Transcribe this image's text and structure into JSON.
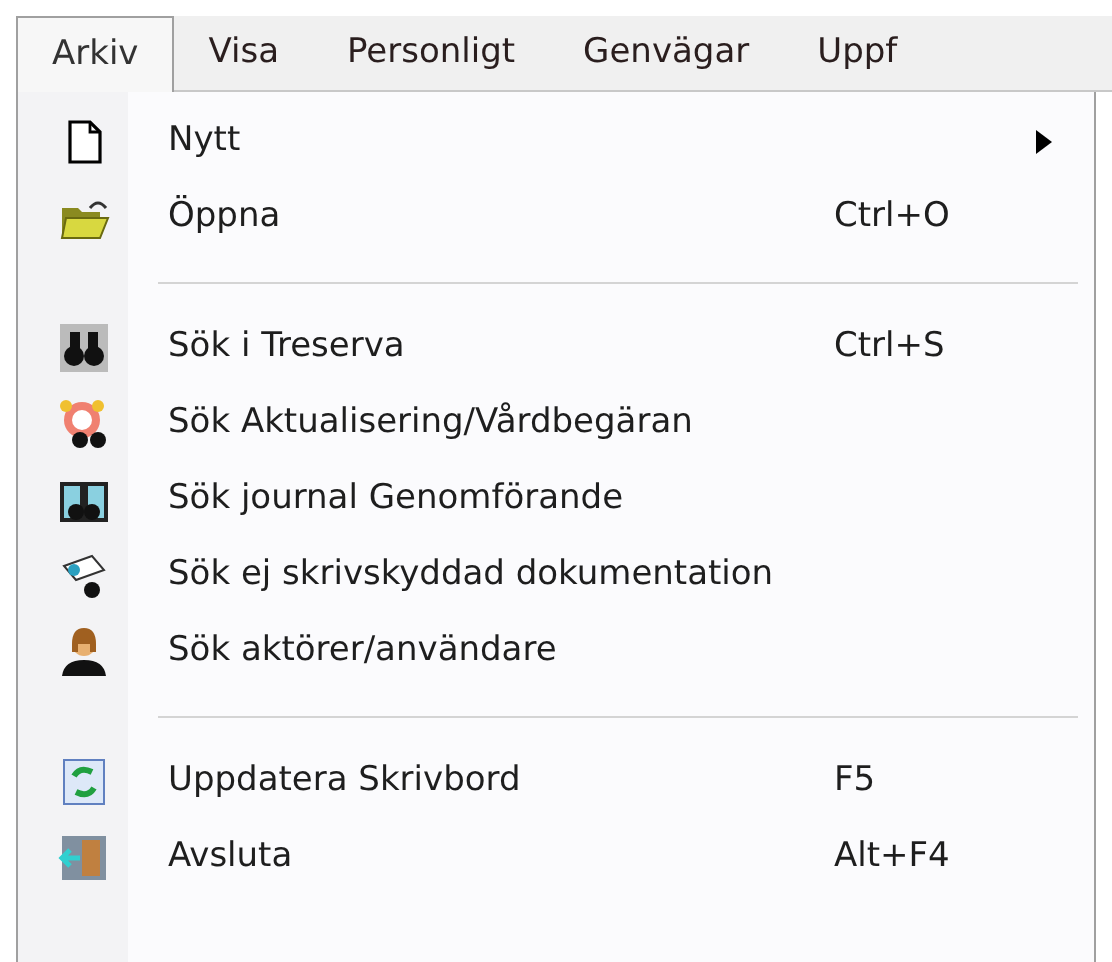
{
  "menu_bar": [
    {
      "label": "Arkiv",
      "selected": true
    },
    {
      "label": "Visa",
      "selected": false
    },
    {
      "label": "Personligt",
      "selected": false
    },
    {
      "label": "Genvägar",
      "selected": false
    },
    {
      "label": "Uppf",
      "selected": false
    }
  ],
  "menu": [
    {
      "kind": "item",
      "label": "Nytt",
      "submenu": true
    },
    {
      "kind": "item",
      "label": "Öppna",
      "shortcut": "Ctrl+O"
    },
    {
      "kind": "separator"
    },
    {
      "kind": "item",
      "label": "Sök i Treserva",
      "shortcut": "Ctrl+S"
    },
    {
      "kind": "item",
      "label": "Sök Aktualisering/Vårdbegäran"
    },
    {
      "kind": "item",
      "label": "Sök journal Genomförande"
    },
    {
      "kind": "item",
      "label": "Sök ej skrivskyddad dokumentation"
    },
    {
      "kind": "item",
      "label": "Sök aktörer/användare"
    },
    {
      "kind": "separator"
    },
    {
      "kind": "item",
      "label": "Uppdatera Skrivbord",
      "shortcut": "F5"
    },
    {
      "kind": "item",
      "label": "Avsluta",
      "shortcut": "Alt+F4"
    }
  ]
}
